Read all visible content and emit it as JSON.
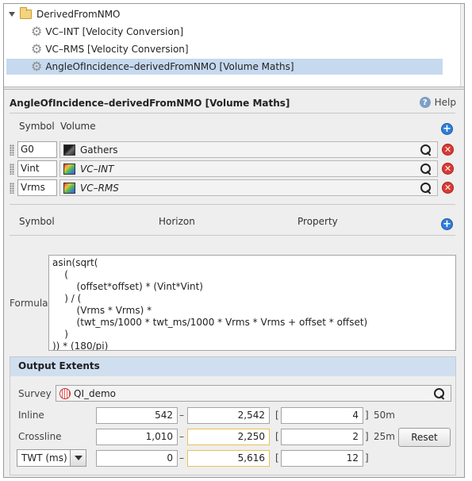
{
  "tree": {
    "folder_label": "DerivedFromNMO",
    "items": [
      {
        "label": "VC–INT [Velocity Conversion]"
      },
      {
        "label": "VC–RMS [Velocity Conversion]"
      },
      {
        "label": "AngleOfIncidence–derivedFromNMO [Volume Maths]"
      }
    ]
  },
  "panel": {
    "title": "AngleOfIncidence–derivedFromNMO [Volume Maths]",
    "help_label": "Help"
  },
  "volumes": {
    "col_symbol": "Symbol",
    "col_volume": "Volume",
    "rows": [
      {
        "symbol": "G0",
        "volume": "Gathers",
        "icon": "gathers-cube-icon"
      },
      {
        "symbol": "Vint",
        "volume": "VC–INT",
        "icon": "velocity-cube-icon"
      },
      {
        "symbol": "Vrms",
        "volume": "VC–RMS",
        "icon": "velocity-cube-icon"
      }
    ]
  },
  "horizons": {
    "col_symbol": "Symbol",
    "col_horizon": "Horizon",
    "col_property": "Property"
  },
  "formula": {
    "label": "Formula",
    "text": "asin(sqrt(\n    (\n        (offset*offset) * (Vint*Vint)\n    ) / (\n        (Vrms * Vrms) *\n        (twt_ms/1000 * twt_ms/1000 * Vrms * Vrms + offset * offset)\n    )\n)) * (180/pi)"
  },
  "output": {
    "title": "Output Extents",
    "survey_label": "Survey",
    "survey_value": "QI_demo",
    "inline_label": "Inline",
    "inline": {
      "from": "542",
      "to": "2,542",
      "step": "4",
      "spacing": "50m"
    },
    "crossline_label": "Crossline",
    "crossline": {
      "from": "1,010",
      "to": "2,250",
      "step": "2",
      "spacing": "25m"
    },
    "time_select": "TWT (ms)",
    "time": {
      "from": "0",
      "to": "5,616",
      "step": "12"
    },
    "reset_label": "Reset",
    "dash": "–",
    "bracket_open": "[",
    "bracket_close": "]"
  },
  "colors": {
    "selection": "#c6d9ef",
    "section_header": "#d0dff0",
    "accent_plus": "#2f7ed8",
    "delete_red": "#d93a32",
    "highlight_border": "#e7c156"
  }
}
